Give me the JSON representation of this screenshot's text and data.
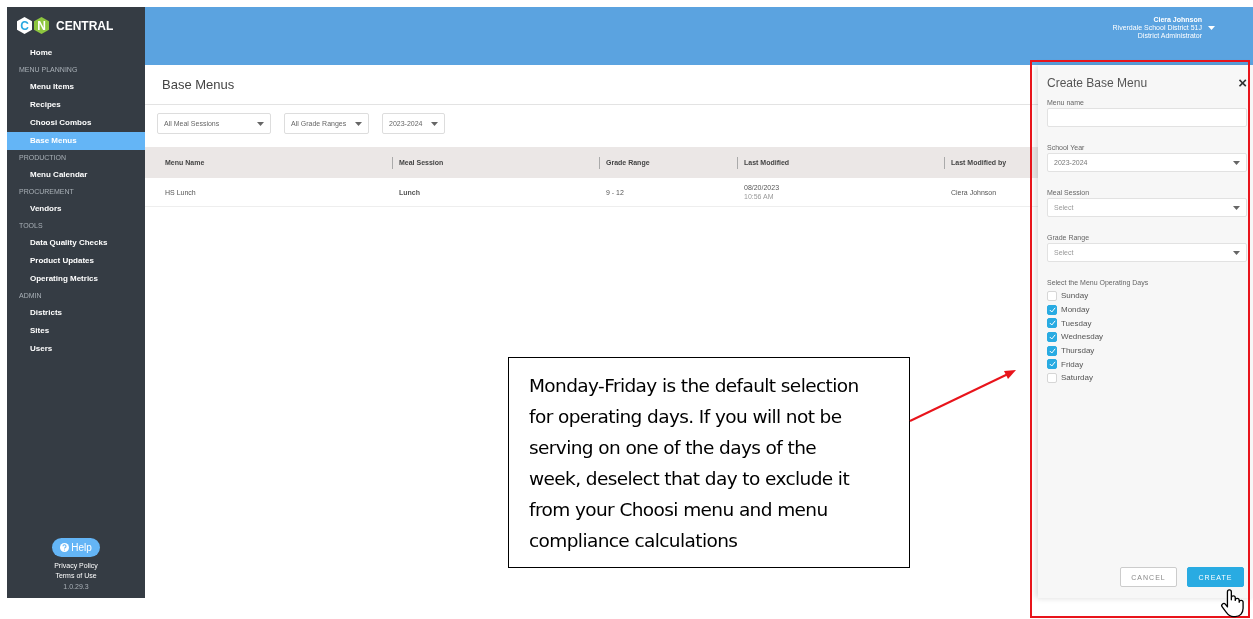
{
  "logo": {
    "letters": [
      "C",
      "N"
    ],
    "name": "CENTRAL"
  },
  "sidebar": {
    "top_items": [
      {
        "label": "Home",
        "selected": false
      }
    ],
    "sections": [
      {
        "title": "MENU PLANNING",
        "items": [
          {
            "label": "Menu Items",
            "selected": false
          },
          {
            "label": "Recipes",
            "selected": false
          },
          {
            "label": "Choosi Combos",
            "selected": false
          },
          {
            "label": "Base Menus",
            "selected": true
          }
        ]
      },
      {
        "title": "PRODUCTION",
        "items": [
          {
            "label": "Menu Calendar",
            "selected": false
          }
        ]
      },
      {
        "title": "PROCUREMENT",
        "items": [
          {
            "label": "Vendors",
            "selected": false
          }
        ]
      },
      {
        "title": "TOOLS",
        "items": [
          {
            "label": "Data Quality Checks",
            "selected": false
          },
          {
            "label": "Product Updates",
            "selected": false
          },
          {
            "label": "Operating Metrics",
            "selected": false
          }
        ]
      },
      {
        "title": "ADMIN",
        "items": [
          {
            "label": "Districts",
            "selected": false
          },
          {
            "label": "Sites",
            "selected": false
          },
          {
            "label": "Users",
            "selected": false
          }
        ]
      }
    ],
    "help": "Help",
    "links": [
      "Privacy Policy",
      "Terms of Use"
    ],
    "version": "1.0.29.3"
  },
  "user": {
    "name": "Ciera Johnson",
    "district": "Riverdale School District 51J",
    "role": "District Administrator"
  },
  "page_title": "Base Menus",
  "filters": [
    "All Meal Sessions",
    "All Grade Ranges",
    "2023-2024"
  ],
  "table": {
    "columns": [
      "Menu Name",
      "Meal Session",
      "Grade Range",
      "Last Modified",
      "Last Modified by"
    ],
    "rows": [
      {
        "menu_name": "HS Lunch",
        "meal_session": "Lunch",
        "grade_range": "9 - 12",
        "date": "08/20/2023",
        "time": "10:56 AM",
        "modified_by": "Ciera Johnson"
      }
    ]
  },
  "panel": {
    "title": "Create Base Menu",
    "close": "×",
    "fields": [
      {
        "label": "Menu name",
        "kind": "text"
      },
      {
        "label": "School Year",
        "kind": "select",
        "value": "2023-2024"
      },
      {
        "label": "Meal Session",
        "kind": "select",
        "placeholder": "Select"
      },
      {
        "label": "Grade Range",
        "kind": "select",
        "placeholder": "Select"
      }
    ],
    "days_label": "Select the Menu Operating Days",
    "days": [
      {
        "label": "Sunday",
        "checked": false
      },
      {
        "label": "Monday",
        "checked": true
      },
      {
        "label": "Tuesday",
        "checked": true
      },
      {
        "label": "Wednesday",
        "checked": true
      },
      {
        "label": "Thursday",
        "checked": true
      },
      {
        "label": "Friday",
        "checked": true
      },
      {
        "label": "Saturday",
        "checked": false
      }
    ],
    "buttons": [
      {
        "label": "CANCEL",
        "kind": "secondary"
      },
      {
        "label": "CREATE",
        "kind": "primary"
      }
    ]
  },
  "callout": {
    "text": "Monday-Friday is the default selection for operating days. If you will not be serving on one of the days of the week, deselect that day to exclude it from your Choosi menu and menu compliance calculations"
  }
}
